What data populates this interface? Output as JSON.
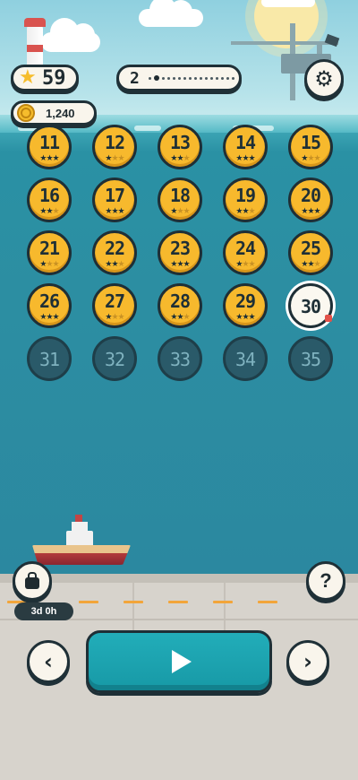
{
  "hud": {
    "stars": "59",
    "coins": "1,240",
    "page": "2"
  },
  "levels": [
    {
      "num": "11",
      "state": "done",
      "stars": 3
    },
    {
      "num": "12",
      "state": "done",
      "stars": 1
    },
    {
      "num": "13",
      "state": "done",
      "stars": 2
    },
    {
      "num": "14",
      "state": "done",
      "stars": 3
    },
    {
      "num": "15",
      "state": "done",
      "stars": 1
    },
    {
      "num": "16",
      "state": "done",
      "stars": 2
    },
    {
      "num": "17",
      "state": "done",
      "stars": 3
    },
    {
      "num": "18",
      "state": "done",
      "stars": 1
    },
    {
      "num": "19",
      "state": "done",
      "stars": 2
    },
    {
      "num": "20",
      "state": "done",
      "stars": 3
    },
    {
      "num": "21",
      "state": "done",
      "stars": 1
    },
    {
      "num": "22",
      "state": "done",
      "stars": 2
    },
    {
      "num": "23",
      "state": "done",
      "stars": 3
    },
    {
      "num": "24",
      "state": "done",
      "stars": 1
    },
    {
      "num": "25",
      "state": "done",
      "stars": 2
    },
    {
      "num": "26",
      "state": "done",
      "stars": 3
    },
    {
      "num": "27",
      "state": "done",
      "stars": 1
    },
    {
      "num": "28",
      "state": "done",
      "stars": 2
    },
    {
      "num": "29",
      "state": "done",
      "stars": 3
    },
    {
      "num": "30",
      "state": "current",
      "stars": 0
    },
    {
      "num": "31",
      "state": "locked",
      "stars": 0
    },
    {
      "num": "32",
      "state": "locked",
      "stars": 0
    },
    {
      "num": "33",
      "state": "locked",
      "stars": 0
    },
    {
      "num": "34",
      "state": "locked",
      "stars": 0
    },
    {
      "num": "35",
      "state": "locked",
      "stars": 0
    }
  ],
  "footer": {
    "timer": "3d 0h",
    "help_label": "?"
  },
  "icons": {
    "star": "star-icon",
    "coin": "coin-icon",
    "settings": "gear-icon",
    "bag": "bag-icon",
    "play": "play-icon",
    "prev": "chevron-left-icon",
    "next": "chevron-right-icon"
  },
  "colors": {
    "level_done": "#f7b92d",
    "level_locked": "#2a5a69",
    "play_button": "#1799a6",
    "outline": "#1e2f36"
  }
}
